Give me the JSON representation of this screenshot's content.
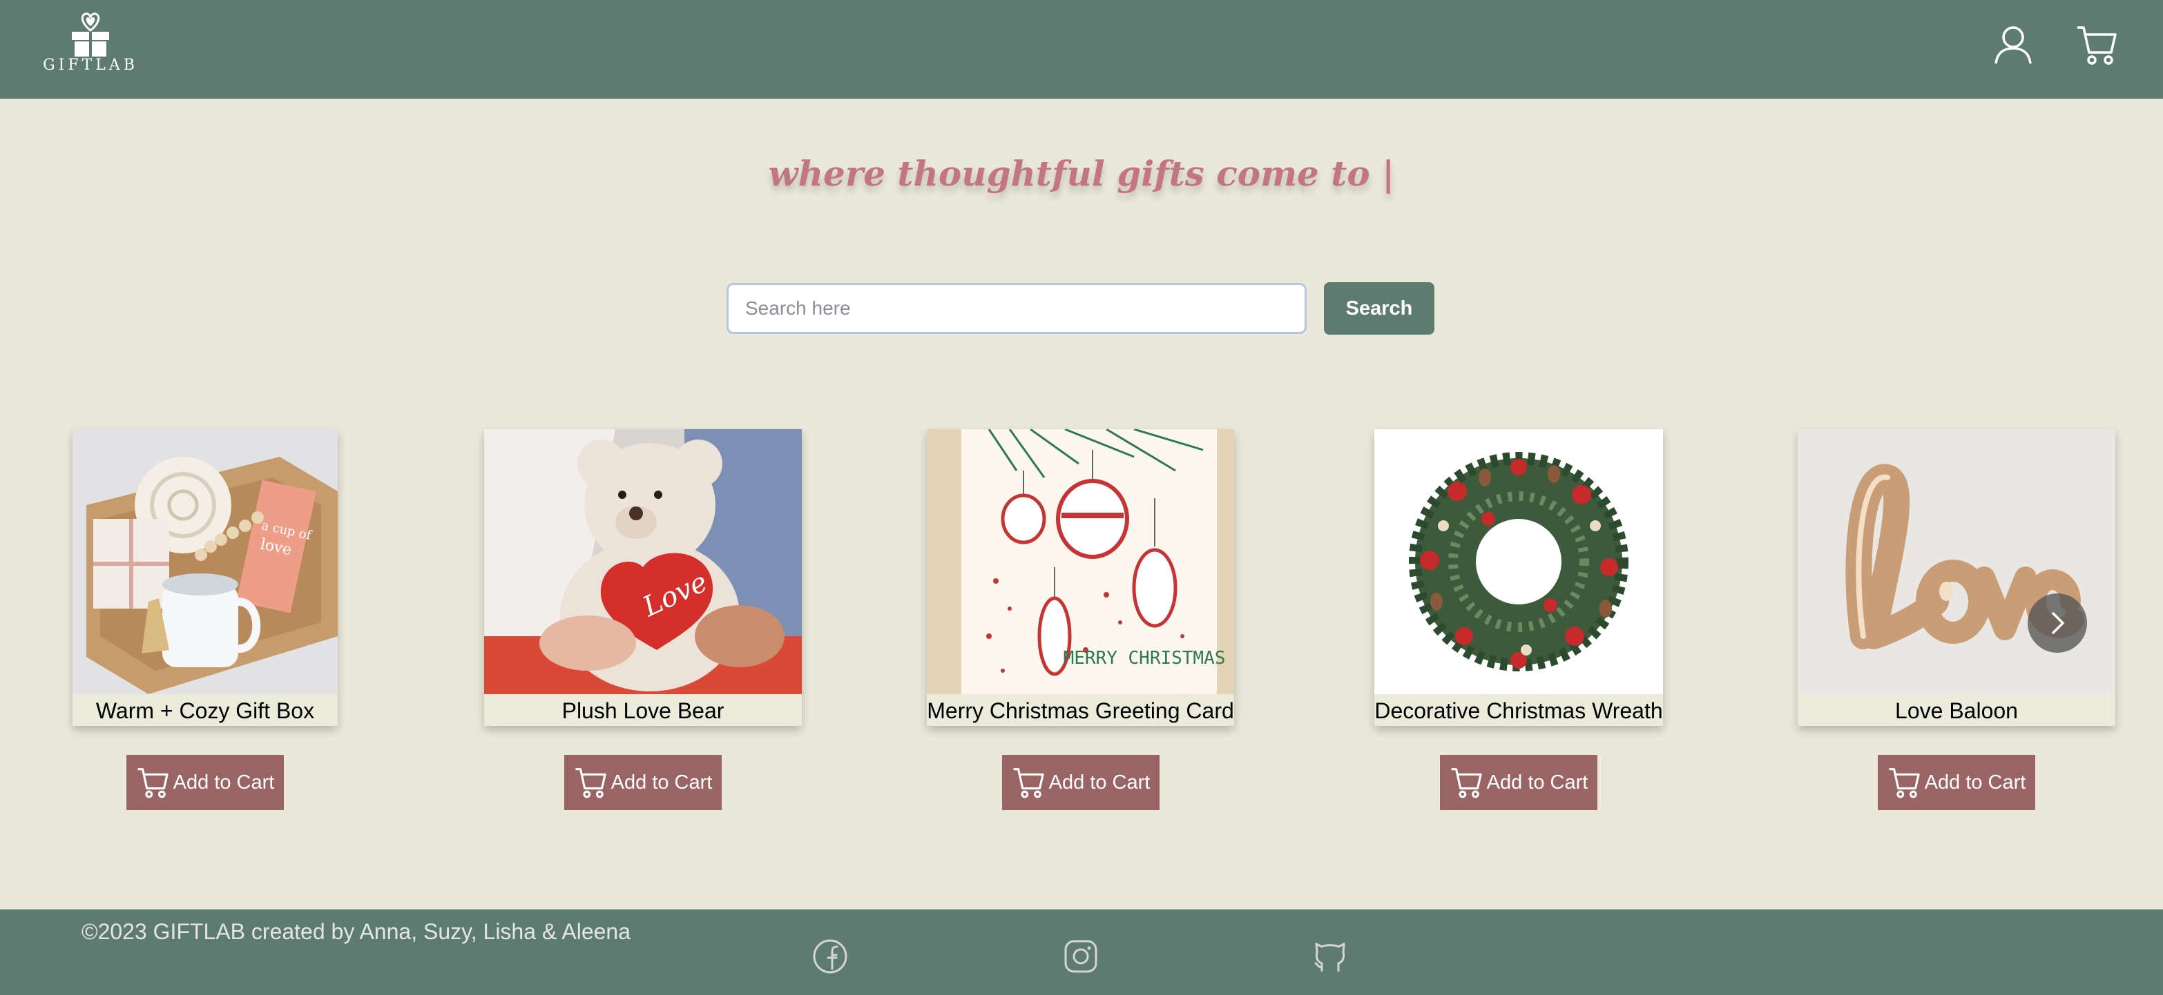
{
  "header": {
    "logo_text": "GIFTLAB",
    "account_icon": "user-icon",
    "cart_icon": "shopping-cart-icon"
  },
  "hero": {
    "tagline": "where thoughtful gifts come to |"
  },
  "search": {
    "placeholder": "Search here",
    "value": "",
    "button_label": "Search"
  },
  "products": [
    {
      "name": "Warm + Cozy Gift Box",
      "button_label": "Add to Cart",
      "image": "gift-box-image"
    },
    {
      "name": "Plush Love Bear",
      "button_label": "Add to Cart",
      "image": "teddy-bear-image"
    },
    {
      "name": "Merry Christmas Greeting Card",
      "button_label": "Add to Cart",
      "image": "christmas-card-image",
      "card_text": "MERRY CHRISTMAS"
    },
    {
      "name": "Decorative Christmas Wreath",
      "button_label": "Add to Cart",
      "image": "wreath-image"
    },
    {
      "name": "Love Baloon",
      "button_label": "Add to Cart",
      "image": "love-balloon-image"
    }
  ],
  "carousel": {
    "next_icon": "chevron-right-icon"
  },
  "footer": {
    "copyright": "©2023 GIFTLAB created by Anna, Suzy, Lisha & Aleena",
    "social": [
      "facebook-icon",
      "instagram-icon",
      "github-icon"
    ]
  },
  "colors": {
    "header_bg": "#5e7b72",
    "page_bg": "#e9e8da",
    "tagline": "#c47680",
    "add_to_cart_bg": "#9b6464",
    "search_button_bg": "#5e7b72"
  }
}
